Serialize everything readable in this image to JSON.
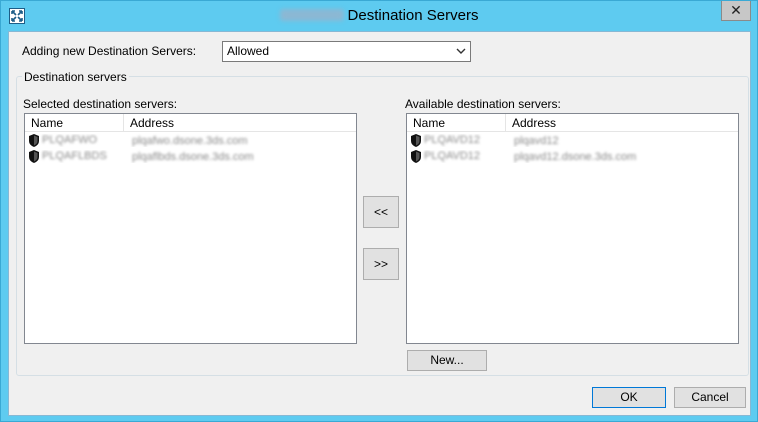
{
  "window": {
    "title": "Destination Servers",
    "close_glyph": "✕"
  },
  "adding": {
    "label": "Adding new Destination Servers:",
    "value": "Allowed"
  },
  "group": {
    "label": "Destination servers"
  },
  "selected": {
    "label": "Selected destination servers:",
    "columns": [
      "Name",
      "Address"
    ],
    "rows": [
      {
        "name": "PLQAFWO",
        "address": "plqafwo.dsone.3ds.com"
      },
      {
        "name": "PLQAFLBDS",
        "address": "plqaflbds.dsone.3ds.com"
      }
    ]
  },
  "available": {
    "label": "Available destination servers:",
    "columns": [
      "Name",
      "Address"
    ],
    "rows": [
      {
        "name": "PLQAVD12",
        "address": "plqavd12"
      },
      {
        "name": "PLQAVD12",
        "address": "plqavd12.dsone.3ds.com"
      }
    ]
  },
  "buttons": {
    "move_left": "<<",
    "move_right": ">>",
    "new": "New...",
    "ok": "OK",
    "cancel": "Cancel"
  },
  "icons": {
    "app": "app-window-icon",
    "server": "shield-icon",
    "dropdown": "chevron-down-icon"
  },
  "colors": {
    "titlebar": "#5ecbf0",
    "client": "#f0f0f0",
    "ok_border": "#0078d7"
  }
}
